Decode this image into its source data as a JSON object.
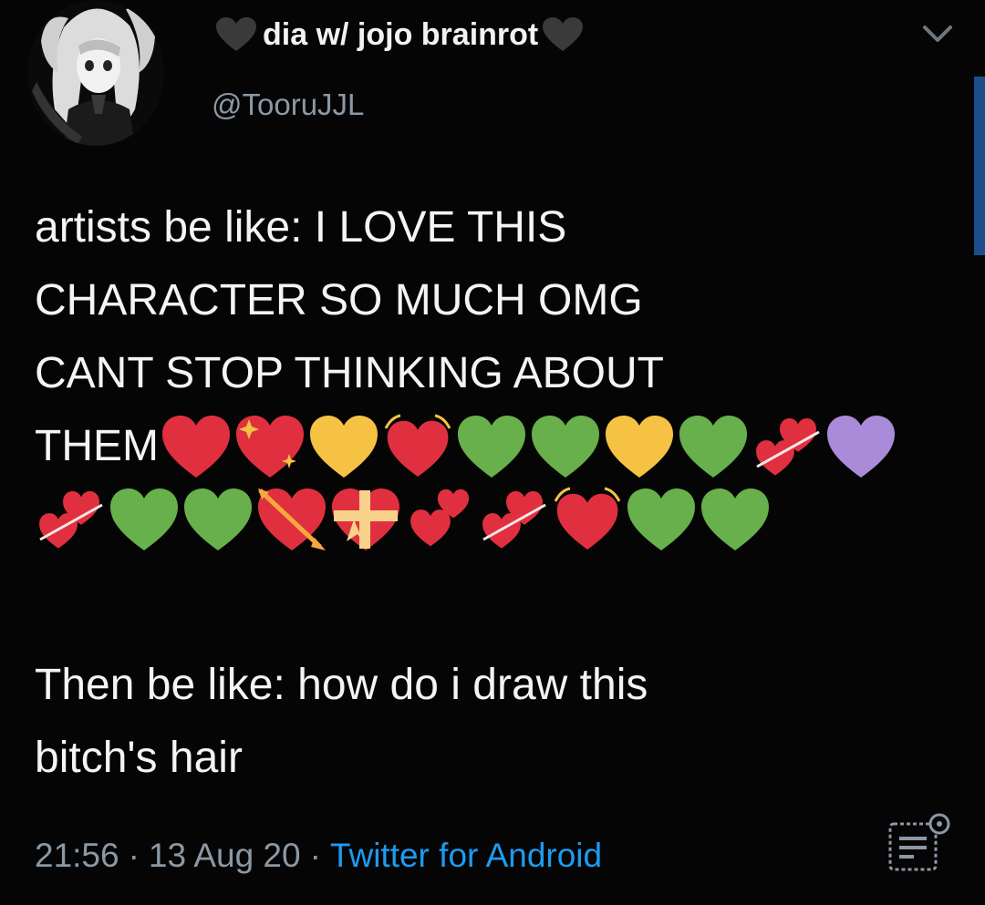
{
  "author": {
    "display_name": "dia w/ jojo brainrot",
    "handle": "@TooruJJL",
    "avatar_icon": "anime-avatar-icon",
    "name_heart_color": "#3a3a3a"
  },
  "menu": {
    "caret_icon": "chevron-down-icon"
  },
  "tweet": {
    "line1": "artists be like: I LOVE THIS",
    "line2": "CHARACTER SO MUCH OMG",
    "line3": "CANT STOP THINKING ABOUT",
    "line4_word": "THEM",
    "emoji_row1": [
      {
        "icon": "red-heart-icon",
        "color": "#e0303f"
      },
      {
        "icon": "sparkling-heart-icon",
        "color": "#e0303f"
      },
      {
        "icon": "yellow-heart-icon",
        "color": "#f6c244"
      },
      {
        "icon": "beating-heart-icon",
        "color": "#e0303f"
      },
      {
        "icon": "green-heart-icon",
        "color": "#67b04b"
      },
      {
        "icon": "green-heart-icon",
        "color": "#67b04b"
      },
      {
        "icon": "yellow-heart-icon",
        "color": "#f6c244"
      },
      {
        "icon": "green-heart-icon",
        "color": "#67b04b"
      },
      {
        "icon": "revolving-hearts-icon",
        "color": "#e0303f"
      },
      {
        "icon": "purple-heart-icon",
        "color": "#a98bd9"
      }
    ],
    "emoji_row2": [
      {
        "icon": "revolving-hearts-icon",
        "color": "#e0303f"
      },
      {
        "icon": "green-heart-icon",
        "color": "#67b04b"
      },
      {
        "icon": "green-heart-icon",
        "color": "#67b04b"
      },
      {
        "icon": "heart-with-arrow-icon",
        "color": "#e0303f"
      },
      {
        "icon": "heart-with-ribbon-icon",
        "color": "#e0303f"
      },
      {
        "icon": "two-hearts-icon",
        "color": "#e0303f"
      },
      {
        "icon": "revolving-hearts-icon",
        "color": "#e0303f"
      },
      {
        "icon": "beating-heart-icon",
        "color": "#e0303f"
      },
      {
        "icon": "green-heart-icon",
        "color": "#67b04b"
      },
      {
        "icon": "green-heart-icon",
        "color": "#67b04b"
      }
    ],
    "line5": "Then be like: how do i draw this",
    "line6": "bitch's hair"
  },
  "meta": {
    "time": "21:56",
    "separator": "·",
    "date": "13 Aug 20",
    "source": "Twitter for Android",
    "analytics_icon": "analytics-icon",
    "source_color": "#1d9bf0"
  }
}
